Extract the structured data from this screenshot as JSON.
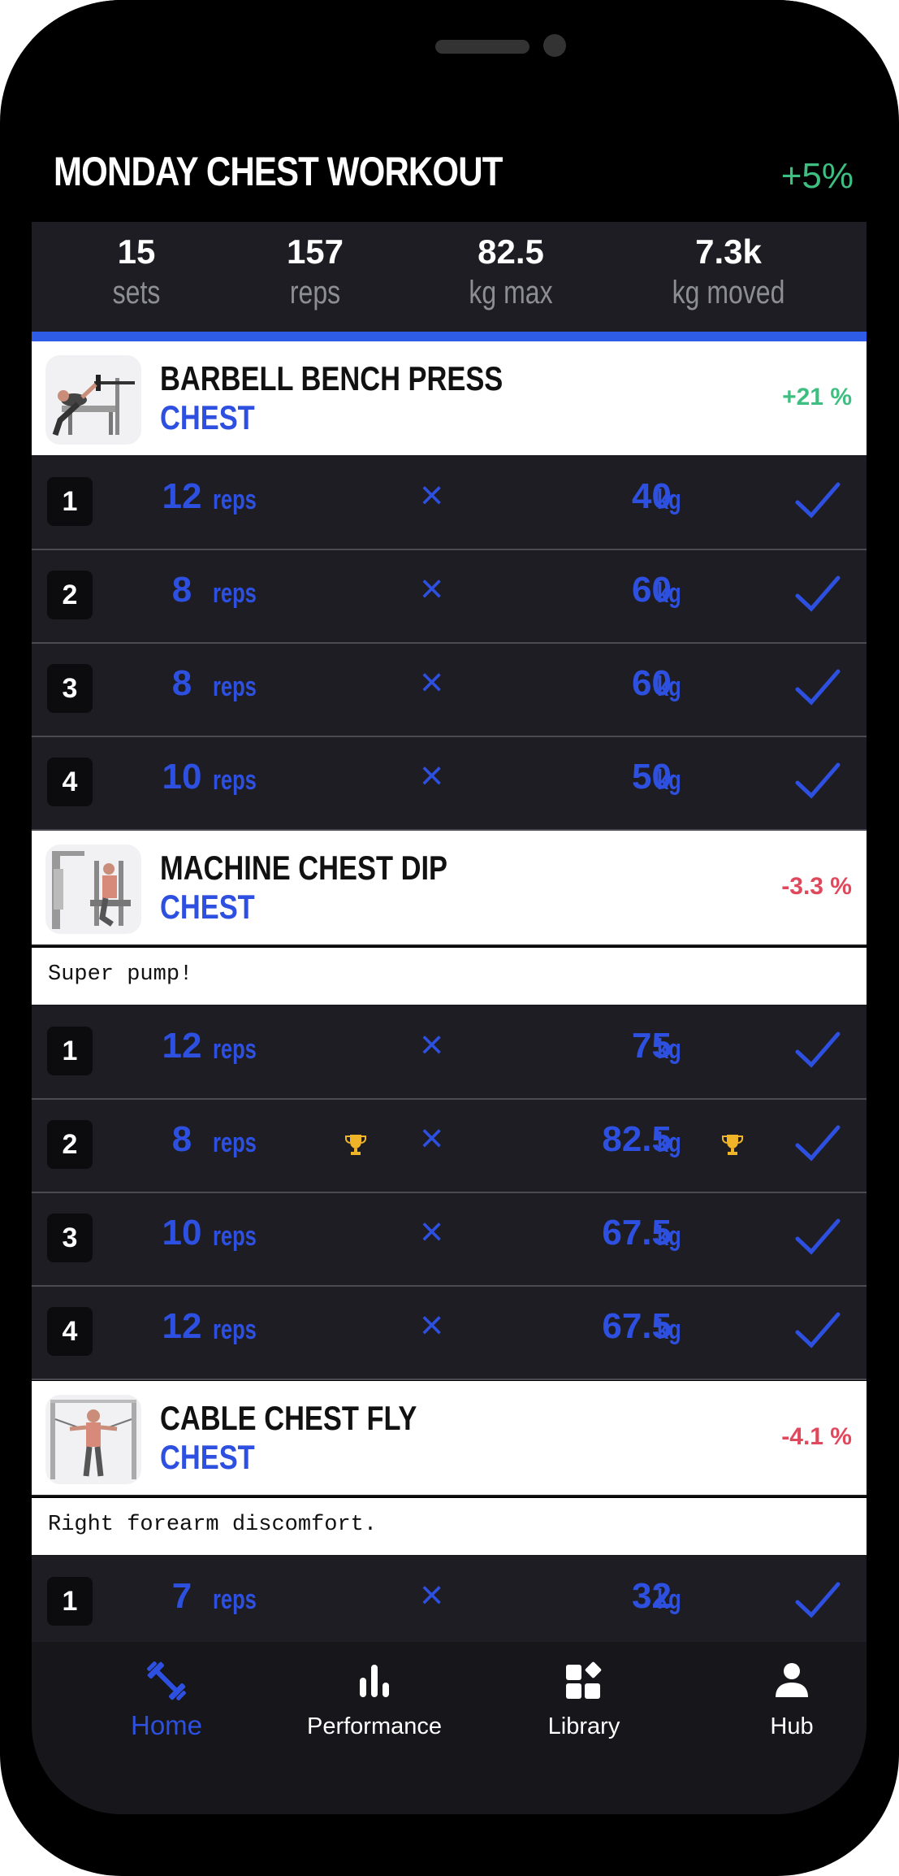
{
  "workout": {
    "title": "MONDAY CHEST WORKOUT",
    "change": "+5%"
  },
  "stats": [
    {
      "value": "15",
      "label": "sets"
    },
    {
      "value": "157",
      "label": "reps"
    },
    {
      "value": "82.5",
      "label": "kg max"
    },
    {
      "value": "7.3k",
      "label": "kg moved"
    }
  ],
  "exercises": [
    {
      "name": "BARBELL BENCH PRESS",
      "muscle": "CHEST",
      "change": "+21 %",
      "sets": [
        {
          "n": "1",
          "reps": "12",
          "reps_unit": "reps",
          "weight": "40",
          "weight_unit": "kg"
        },
        {
          "n": "2",
          "reps": "8",
          "reps_unit": "reps",
          "weight": "60",
          "weight_unit": "kg"
        },
        {
          "n": "3",
          "reps": "8",
          "reps_unit": "reps",
          "weight": "60",
          "weight_unit": "kg"
        },
        {
          "n": "4",
          "reps": "10",
          "reps_unit": "reps",
          "weight": "50",
          "weight_unit": "kg"
        }
      ]
    },
    {
      "name": "MACHINE CHEST DIP",
      "muscle": "CHEST",
      "change": "-3.3 %",
      "note": "Super pump!",
      "sets": [
        {
          "n": "1",
          "reps": "12",
          "reps_unit": "reps",
          "weight": "75",
          "weight_unit": "kg"
        },
        {
          "n": "2",
          "reps": "8",
          "reps_unit": "reps",
          "weight": "82.5",
          "weight_unit": "kg"
        },
        {
          "n": "3",
          "reps": "10",
          "reps_unit": "reps",
          "weight": "67.5",
          "weight_unit": "kg"
        },
        {
          "n": "4",
          "reps": "12",
          "reps_unit": "reps",
          "weight": "67.5",
          "weight_unit": "kg"
        }
      ]
    },
    {
      "name": "CABLE CHEST FLY",
      "muscle": "CHEST",
      "change": "-4.1 %",
      "note": "Right forearm discomfort.",
      "sets": [
        {
          "n": "1",
          "reps": "7",
          "reps_unit": "reps",
          "weight": "32",
          "weight_unit": "kg"
        }
      ]
    }
  ],
  "times_symbol": "×",
  "nav": [
    {
      "label": "Home",
      "icon": "dumbbell-icon",
      "active": true
    },
    {
      "label": "Performance",
      "icon": "bar-chart-icon",
      "active": false
    },
    {
      "label": "Library",
      "icon": "library-grid-icon",
      "active": false
    },
    {
      "label": "Hub",
      "icon": "person-icon",
      "active": false
    }
  ],
  "colors": {
    "accent": "#2e50e0",
    "positive": "#3fbe82",
    "negative": "#e0485c",
    "trophy": "#f0b429",
    "row_bg": "#1d1d23"
  }
}
